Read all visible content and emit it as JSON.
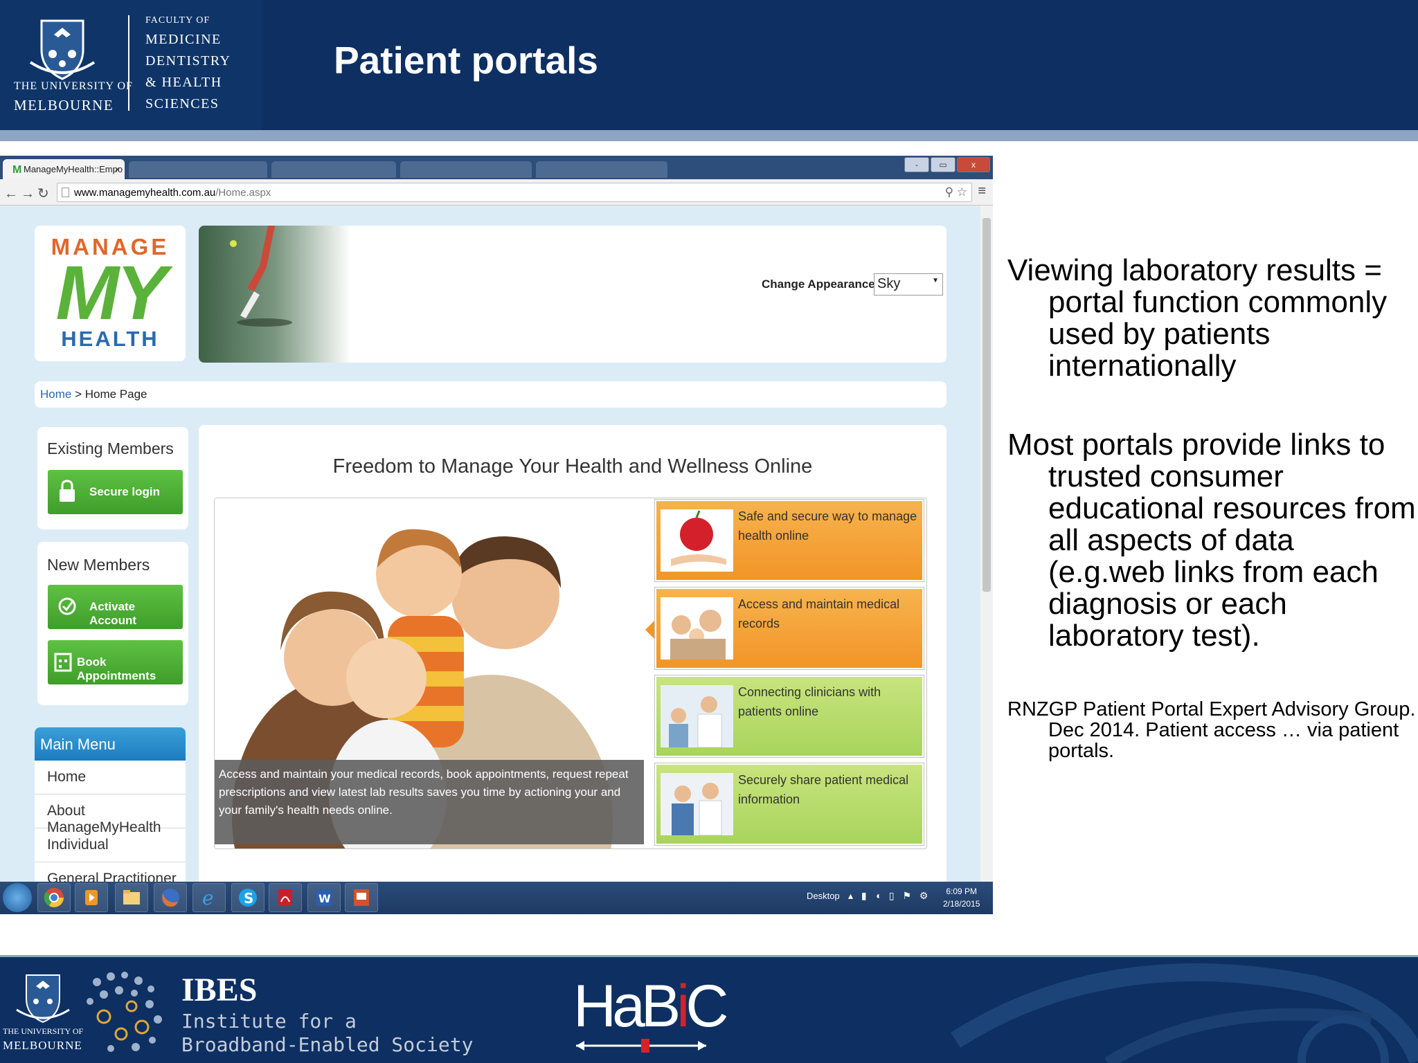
{
  "header": {
    "title": "Patient portals",
    "university_of": "THE UNIVERSITY OF",
    "university_name": "MELBOURNE",
    "faculty_lines": [
      "FACULTY OF",
      "MEDICINE",
      "DENTISTRY",
      "& HEALTH",
      "SCIENCES"
    ]
  },
  "bullets": [
    "Viewing laboratory results = portal function commonly used by patients internationally",
    "Most portals provide links to trusted consumer educational resources from all aspects of data (e.g.web links from each diagnosis or each laboratory test)."
  ],
  "citation": "RNZGP Patient Portal Expert Advisory Group. Dec 2014. Patient access … via patient portals.",
  "browser": {
    "tab_title": "ManageMyHealth::Empo",
    "tab_close": "×",
    "url_domain": "www.managemyhealth.com.au",
    "url_path": "/Home.aspx",
    "window_buttons": [
      "-",
      "▭",
      "x"
    ]
  },
  "site": {
    "logo": [
      "MANAGE",
      "MY",
      "HEALTH"
    ],
    "change_appearance_label": "Change Appearance",
    "appearance_value": "Sky",
    "breadcrumb_home": "Home",
    "breadcrumb_sep": " > ",
    "breadcrumb_current": "Home Page",
    "existing_title": "Existing Members",
    "secure_login": "Secure login",
    "new_title": "New Members",
    "activate": "Activate Account",
    "book": "Book Appointments",
    "main_menu": "Main Menu",
    "menu_items": [
      "Home",
      "About ManageMyHealth",
      "Individual",
      "General Practitioner"
    ],
    "headline": "Freedom to Manage Your Health and Wellness Online",
    "caption": "Access and maintain your medical records, book appointments, request repeat prescriptions and view latest lab results saves you time by actioning your and your family's health needs online.",
    "features": [
      "Safe and secure way to manage health online",
      "Access and maintain medical records",
      "Connecting clinicians with patients online",
      "Securely share patient medical information"
    ]
  },
  "taskbar": {
    "desktop_label": "Desktop",
    "time": "6:09 PM",
    "date": "2/18/2015"
  },
  "footer": {
    "university_of": "THE UNIVERSITY OF",
    "university_name": "MELBOURNE",
    "ibes": "IBES",
    "ibes_line1": "Institute for a",
    "ibes_line2": "Broadband-Enabled Society",
    "habic_a": "HaB",
    "habic_i": "i",
    "habic_c": "C"
  },
  "colors": {
    "navy": "#0d2f62",
    "stripe": "#8ea5c2",
    "green_button": "#4caf34",
    "orange_feature": "#f29527",
    "green_feature": "#a8d45c",
    "link_blue": "#2a6ab1"
  }
}
